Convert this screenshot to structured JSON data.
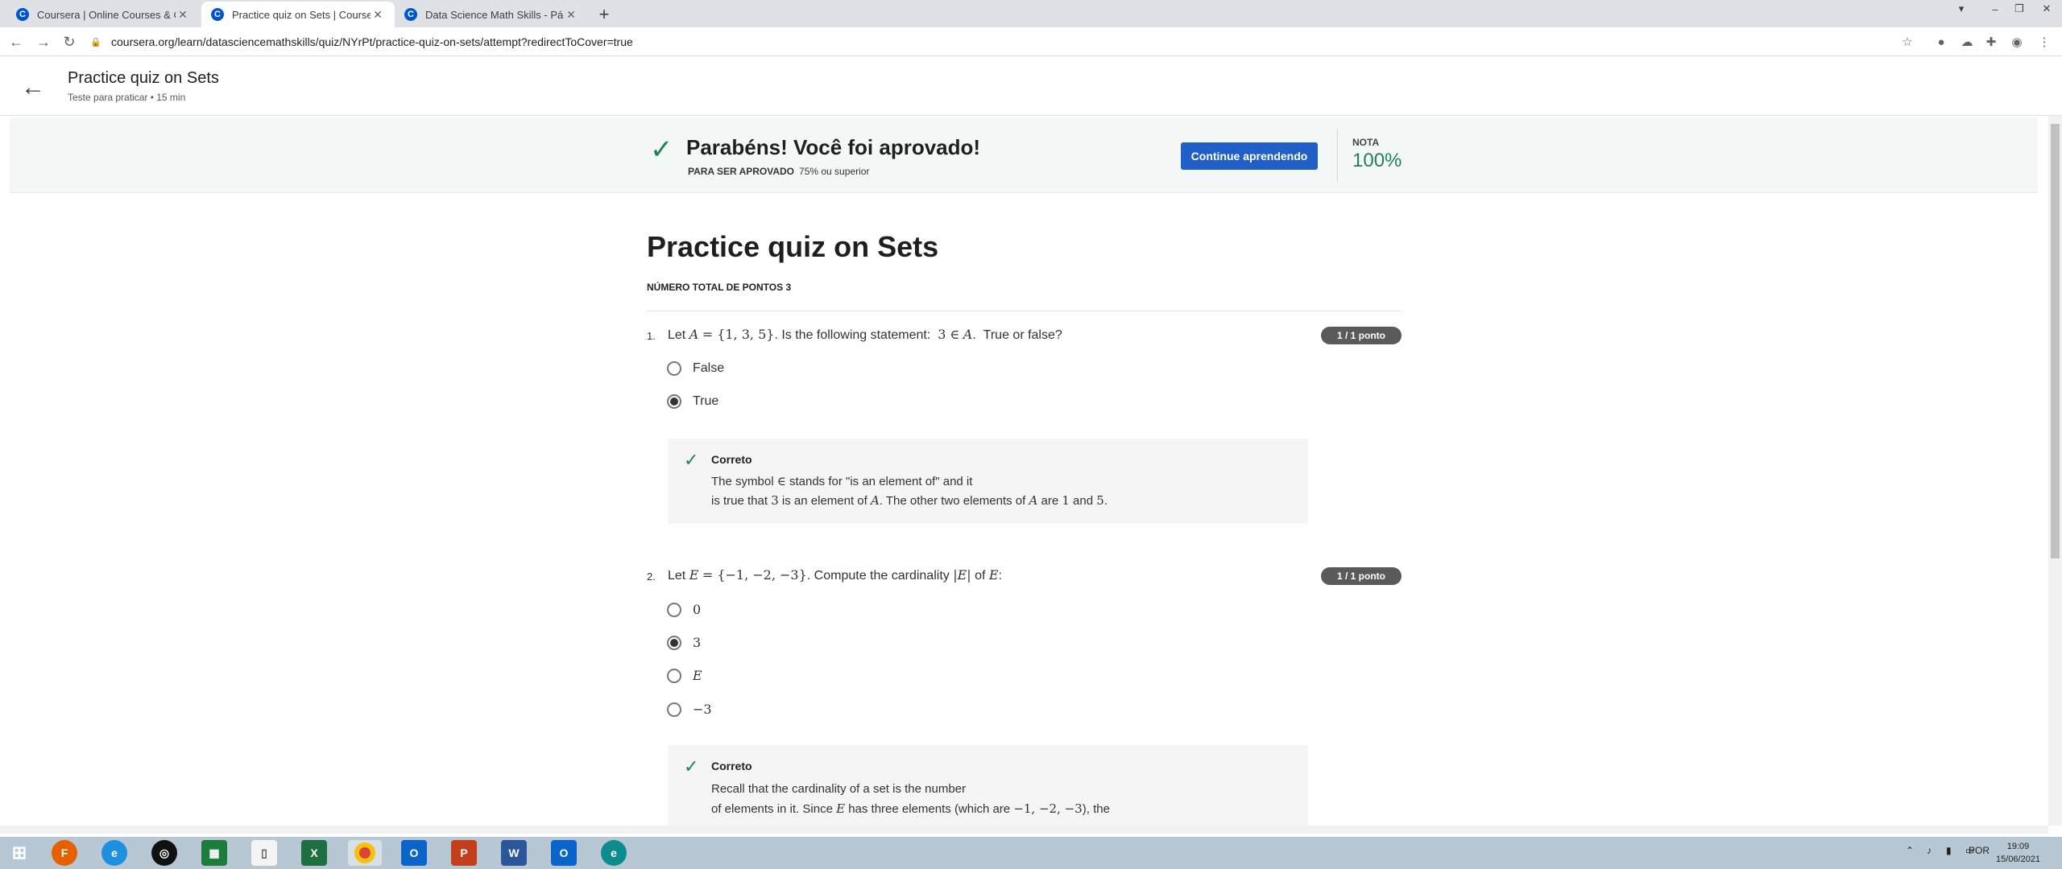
{
  "browser": {
    "tabs": [
      {
        "title": "Coursera | Online Courses & Cre"
      },
      {
        "title": "Practice quiz on Sets | Coursera"
      },
      {
        "title": "Data Science Math Skills - Página"
      }
    ],
    "url": "coursera.org/learn/datasciencemathskills/quiz/NYrPt/practice-quiz-on-sets/attempt?redirectToCover=true"
  },
  "header": {
    "title": "Practice quiz on Sets",
    "subtitle": "Teste para praticar • 15 min"
  },
  "banner": {
    "message": "Parabéns! Você foi aprovado!",
    "pass_label": "PARA SER APROVADO",
    "pass_value": "75% ou superior",
    "continue_label": "Continue aprendendo",
    "grade_label": "NOTA",
    "grade_value": "100%",
    "accent": "#1f8354",
    "button_color": "#1f5fc7"
  },
  "quiz": {
    "title": "Practice quiz on Sets",
    "total_points": "NÚMERO TOTAL DE PONTOS 3",
    "questions": [
      {
        "number": "1.",
        "points": "1 / 1 ponto",
        "options": [
          {
            "label": "False",
            "selected": false
          },
          {
            "label": "True",
            "selected": true
          }
        ],
        "feedback_head": "Correto"
      },
      {
        "number": "2.",
        "points": "1 / 1 ponto",
        "options": [
          {
            "label": "0",
            "selected": false
          },
          {
            "label": "3",
            "selected": true
          },
          {
            "label": "E",
            "selected": false
          },
          {
            "label": "−3",
            "selected": false
          }
        ],
        "feedback_head": "Correto"
      }
    ]
  },
  "taskbar": {
    "lang": "POR",
    "time": "19:09",
    "date": "15/06/2021"
  }
}
